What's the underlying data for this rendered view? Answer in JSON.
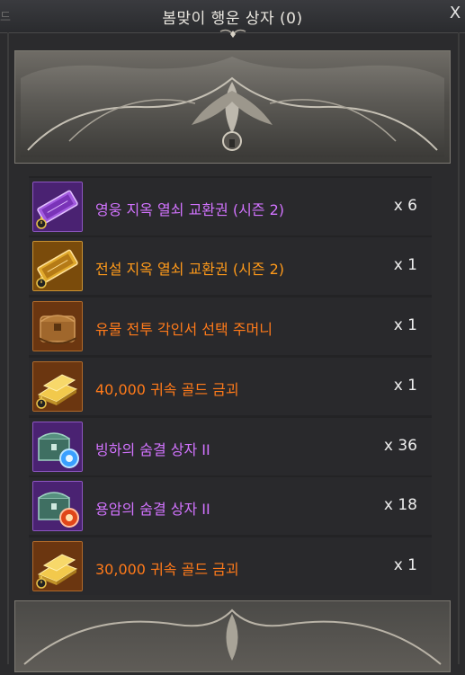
{
  "window": {
    "left_fragment": "드",
    "title": "봄맞이 행운 상자 (0)",
    "close_label": "X"
  },
  "colors": {
    "epic": "#d273ff",
    "legendary": "#ff9a1a",
    "relic": "#ff7a1a",
    "epic_bg": "#5b2d86",
    "legendary_bg": "#8d5a0e",
    "relic_bg": "#7a3e12"
  },
  "items": [
    {
      "name": "영웅 지옥 열쇠 교환권 (시즌 2)",
      "qty": "x 6",
      "grade": "epic",
      "icon": "purple-ticket-icon"
    },
    {
      "name": "전설 지옥 열쇠 교환권 (시즌 2)",
      "qty": "x 1",
      "grade": "legendary",
      "icon": "gold-ticket-icon"
    },
    {
      "name": "유물 전투 각인서 선택 주머니",
      "qty": "x 1",
      "grade": "relic",
      "icon": "leather-pouch-icon"
    },
    {
      "name": "40,000 귀속 골드 금괴",
      "qty": "x 1",
      "grade": "relic",
      "icon": "gold-bar-icon"
    },
    {
      "name": "빙하의 숨결 상자 II",
      "qty": "x 36",
      "grade": "epic",
      "icon": "frost-chest-icon"
    },
    {
      "name": "용암의 숨결 상자 II",
      "qty": "x 18",
      "grade": "epic",
      "icon": "lava-chest-icon"
    },
    {
      "name": "30,000 귀속 골드 금괴",
      "qty": "x 1",
      "grade": "relic",
      "icon": "gold-bar-icon"
    }
  ]
}
